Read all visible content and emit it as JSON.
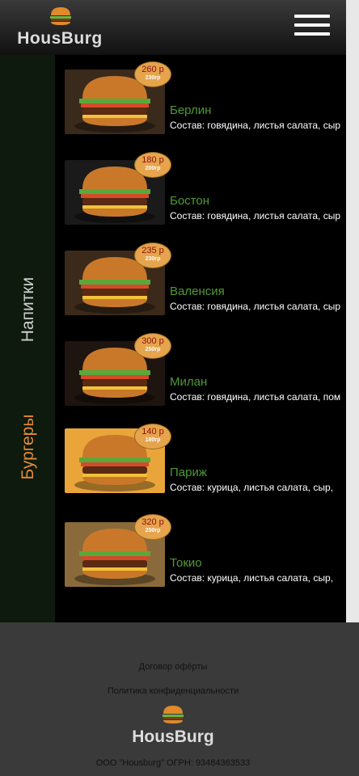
{
  "header": {
    "brand": "HousBurg",
    "logo_icon": "burger-logo-icon",
    "menu_icon": "hamburger-menu-icon"
  },
  "sidebar": {
    "items": [
      {
        "label": "Напитки",
        "active": false
      },
      {
        "label": "Бургеры",
        "active": true
      }
    ]
  },
  "products": [
    {
      "price": "260 р",
      "weight": "230гр",
      "name": "Берлин",
      "desc": "Состав: говядина, листья салата, сыр"
    },
    {
      "price": "180 р",
      "weight": "200гр",
      "name": "Бостон",
      "desc": "Состав: говядина, листья салата, сыр"
    },
    {
      "price": "235 р",
      "weight": "230гр",
      "name": "Валенсия",
      "desc": "Состав: говядина, листья салата, сыр"
    },
    {
      "price": "300 р",
      "weight": "250гр",
      "name": "Милан",
      "desc": "Состав: говядина, листья салата, пом"
    },
    {
      "price": "140 р",
      "weight": "180гр",
      "name": "Париж",
      "desc": "Состав: курица, листья салата, сыр,"
    },
    {
      "price": "320 р",
      "weight": "250гр",
      "name": "Токио",
      "desc": "Состав: курица, листья салата, сыр,"
    }
  ],
  "footer": {
    "offer": "Договор офёрты",
    "privacy": "Политика конфиденциальности",
    "brand": "HousBurg",
    "copyright": "ООО \"Housburg\" ОГРН: 93484363533"
  },
  "colors": {
    "accent_orange": "#e38b3a",
    "name_green": "#4e9a33",
    "badge": "#e6a44d",
    "sidebar_bg": "#0d1a0d"
  }
}
